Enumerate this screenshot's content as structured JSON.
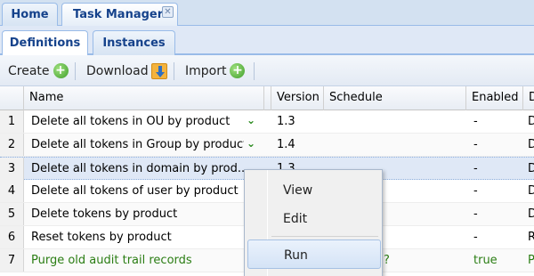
{
  "top_tabs": {
    "home": "Home",
    "task_manager": "Task Manager",
    "close_glyph": "✕"
  },
  "sub_tabs": {
    "definitions": "Definitions",
    "instances": "Instances"
  },
  "toolbar": {
    "create": "Create",
    "download": "Download",
    "import": "Import"
  },
  "grid": {
    "columns": [
      "Name",
      "Version",
      "Schedule",
      "Enabled",
      "D"
    ],
    "rows": [
      {
        "num": "1",
        "name": "Delete all tokens in OU by product",
        "version": "1.3",
        "schedule": "",
        "enabled": "-",
        "d": "D"
      },
      {
        "num": "2",
        "name": "Delete all tokens in Group by product",
        "version": "1.4",
        "schedule": "",
        "enabled": "-",
        "d": "D"
      },
      {
        "num": "3",
        "name": "Delete all tokens in domain by prod...",
        "version": "1.3",
        "schedule": "",
        "enabled": "-",
        "d": "D"
      },
      {
        "num": "4",
        "name": "Delete all tokens of user by product",
        "version": "",
        "schedule": "",
        "enabled": "-",
        "d": "D"
      },
      {
        "num": "5",
        "name": "Delete tokens by product",
        "version": "",
        "schedule": "",
        "enabled": "-",
        "d": "D"
      },
      {
        "num": "6",
        "name": "Reset tokens by product",
        "version": "",
        "schedule": "",
        "enabled": "-",
        "d": "R"
      },
      {
        "num": "7",
        "name": "Purge old audit trail records",
        "version": "",
        "schedule": "?",
        "enabled": "true",
        "d": "P"
      }
    ]
  },
  "context_menu": {
    "view": "View",
    "edit": "Edit",
    "run": "Run"
  },
  "colors": {
    "accent": "#15428b",
    "selected_row": "#dfe8f6",
    "enabled_green": "#2a7d13"
  }
}
